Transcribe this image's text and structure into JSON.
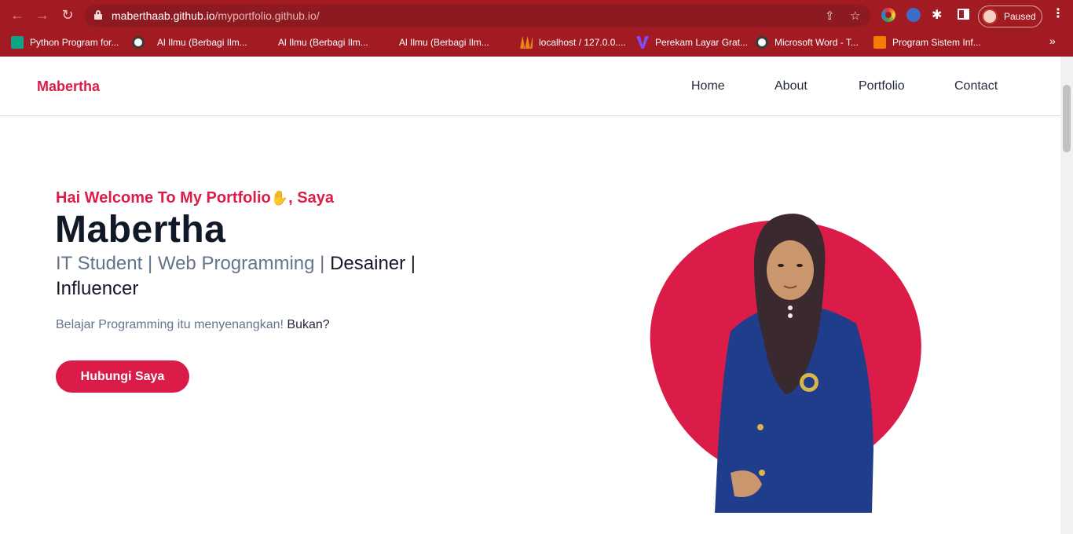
{
  "browser": {
    "url_domain": "maberthaab.github.io",
    "url_path": "/myportfolio.github.io/",
    "profile_label": "Paused",
    "bookmarks": [
      {
        "label": "Python Program for...",
        "icon": "teal-c-icon"
      },
      {
        "label": "",
        "icon": "globe-icon"
      },
      {
        "label": "Al Ilmu (Berbagi Ilm...",
        "icon": "page-icon"
      },
      {
        "label": "Al Ilmu (Berbagi Ilm...",
        "icon": "page-icon"
      },
      {
        "label": "Al Ilmu (Berbagi Ilm...",
        "icon": "page-icon"
      },
      {
        "label": "localhost / 127.0.0....",
        "icon": "phpmyadmin-icon"
      },
      {
        "label": "Perekam Layar Grat...",
        "icon": "v-icon"
      },
      {
        "label": "Microsoft Word - T...",
        "icon": "globe-icon"
      },
      {
        "label": "Program Sistem Inf...",
        "icon": "blogger-icon"
      }
    ],
    "more_bookmarks": "»"
  },
  "site": {
    "brand": "Mabertha",
    "nav": [
      "Home",
      "About",
      "Portfolio",
      "Contact"
    ],
    "hero": {
      "greeting": "Hai Welcome To My Portfolio",
      "greeting_suffix": ", Saya",
      "name": "Mabertha",
      "roles_muted": "IT Student | Web Programming |",
      "roles_dark": "Desainer | Influencer",
      "tagline_muted": "Belajar Programming itu menyenangkan!",
      "tagline_dark": "Bukan?",
      "cta_label": "Hubungi Saya"
    }
  },
  "colors": {
    "accent": "#dc1c48",
    "chrome": "#a31b22",
    "text_dark": "#111827",
    "text_muted": "#64748b"
  }
}
